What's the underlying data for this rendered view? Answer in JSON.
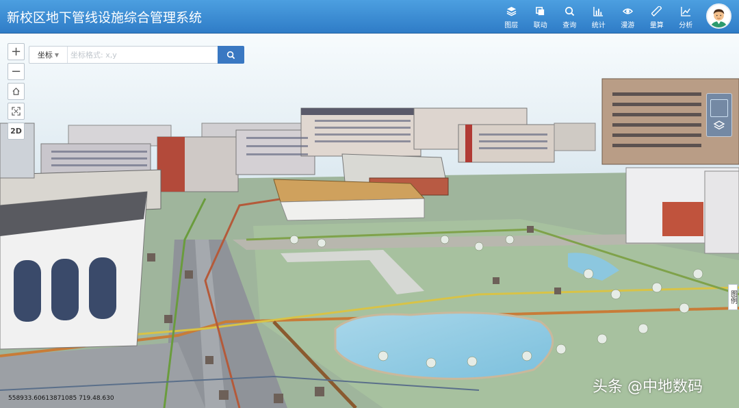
{
  "app": {
    "title": "新校区地下管线设施综合管理系统"
  },
  "nav": [
    {
      "label": "图层",
      "icon": "layers-icon"
    },
    {
      "label": "联动",
      "icon": "copy-icon"
    },
    {
      "label": "查询",
      "icon": "search-icon"
    },
    {
      "label": "统计",
      "icon": "bar-chart-icon"
    },
    {
      "label": "漫游",
      "icon": "eye-icon"
    },
    {
      "label": "量算",
      "icon": "ruler-icon"
    },
    {
      "label": "分析",
      "icon": "line-chart-icon"
    }
  ],
  "map_controls": {
    "zoom_in": "+",
    "zoom_out": "−",
    "mode_2d": "2D"
  },
  "search": {
    "select_label": "坐标",
    "placeholder": "坐标格式: x,y",
    "value": ""
  },
  "legend_tab": "图例",
  "status": {
    "coordinates": "558933.60613871085 719.48.630"
  },
  "watermark": "头条 @中地数码",
  "colors": {
    "header": "#3b88d1",
    "accent": "#3a78c2"
  }
}
